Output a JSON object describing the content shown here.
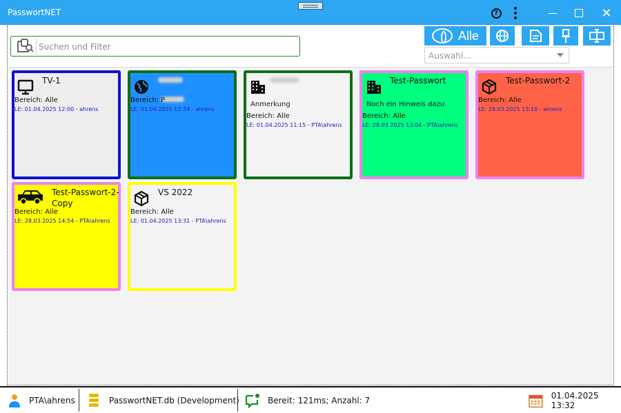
{
  "window": {
    "title": "PasswortNET"
  },
  "search": {
    "placeholder": "Suchen und Filter"
  },
  "filter": {
    "all_label": "Alle",
    "select_placeholder": "Auswahl..."
  },
  "tiles": [
    {
      "name": "TV-1",
      "note": "",
      "area": "Bereich: Alle",
      "le": "LE: 01.04.2025 12:00 - ahrens",
      "icon": "monitor-icon",
      "bg": "#ededed",
      "border": "#1111cc"
    },
    {
      "name": "",
      "note": "",
      "area": "Bereich: P",
      "le": "LE: 01.04.2025 12:34 - ahrens",
      "icon": "globe-icon",
      "bg": "#1e90ff",
      "border": "#0d6e17"
    },
    {
      "name": "",
      "note": "Anmerkung",
      "area": "Bereich: Alle",
      "le": "LE: 01.04.2025 11:15 - PTA\\ahrens",
      "icon": "building-icon",
      "bg": "#f3f3f3",
      "border": "#0d6e17"
    },
    {
      "name": "Test-Passwort",
      "note": "Noch ein Hinweis dazu",
      "area": "Bereich: Alle",
      "le": "LE: 28.03.2025 13:04 - PTA\\ahrens",
      "icon": "building-icon",
      "bg": "#00ff7f",
      "border": "#ee82ee"
    },
    {
      "name": "Test-Passwort-2",
      "note": "",
      "area": "Bereich: Alle",
      "le": "LE: 28.03.2025 13:10 - ahrens",
      "icon": "box-icon",
      "bg": "#ff6347",
      "border": "#ee82ee"
    },
    {
      "name": "Test-Passwort-2-Copy",
      "note": "",
      "area": "Bereich: Alle",
      "le": "LE: 28.03.2025 14:54 - PTA\\ahrens",
      "icon": "car-icon",
      "bg": "#ffff00",
      "border": "#ee82ee"
    },
    {
      "name": "VS 2022",
      "note": "",
      "area": "Bereich: Alle",
      "le": "LE: 01.04.2025 13:31 - PTA\\ahrens",
      "icon": "box-icon",
      "bg": "#f3f3f3",
      "border": "#ffff00"
    }
  ],
  "status": {
    "user": "PTA\\ahrens",
    "database": "PasswortNET.db (Development)",
    "state": "Bereit: 121ms; Anzahl: 7",
    "datetime": "01.04.2025 13:32"
  }
}
